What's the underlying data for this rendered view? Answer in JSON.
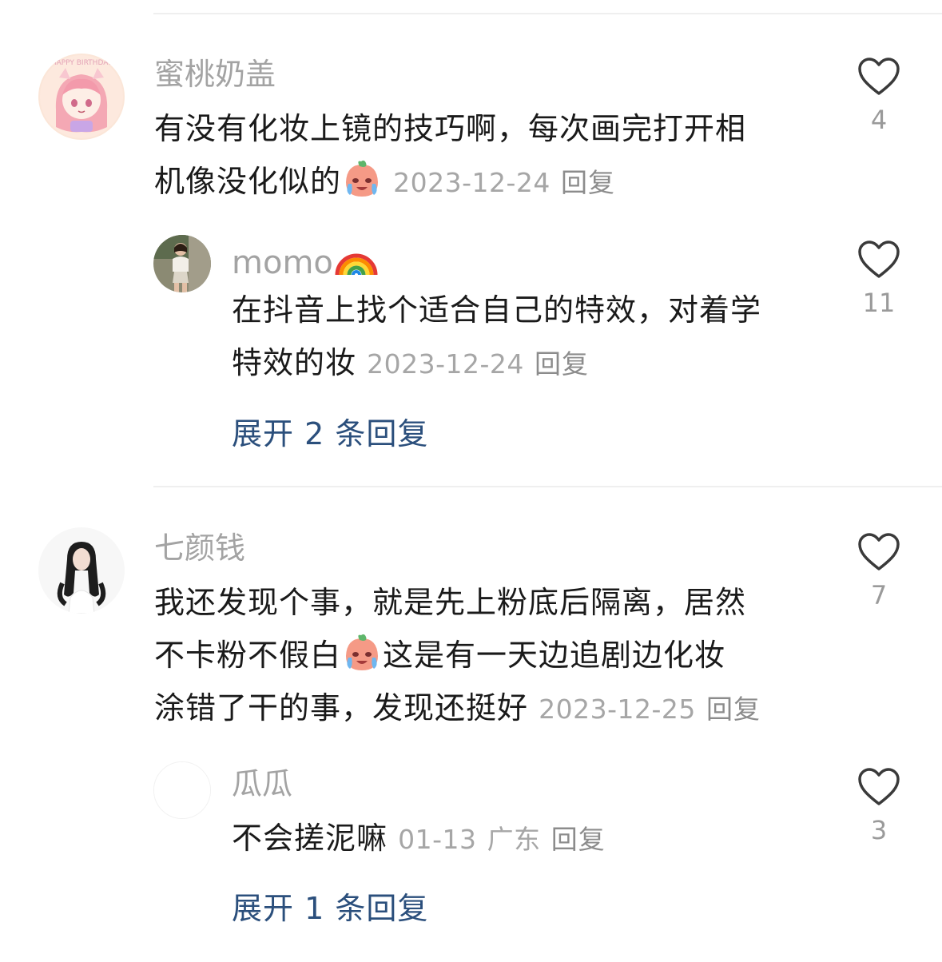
{
  "comments": [
    {
      "username": "蜜桃奶盖",
      "text_lines": [
        "有没有化妆上镜的技巧啊，每次画完打开相",
        "机像没化似的"
      ],
      "emoji": "crying-face-emoji",
      "date": "2023-12-24",
      "reply_label": "回复",
      "likes": "4",
      "replies": [
        {
          "username": "momo",
          "username_emoji": "rainbow-emoji",
          "text_lines": [
            "在抖音上找个适合自己的特效，对着学",
            "特效的妆"
          ],
          "date": "2023-12-24",
          "reply_label": "回复",
          "likes": "11"
        }
      ],
      "expand_label": "展开 2 条回复"
    },
    {
      "username": "七颜钱",
      "text_lines": [
        "我还发现个事，就是先上粉底后隔离，居然",
        "不卡粉不假白",
        "这是有一天边追剧边化妆",
        "涂错了干的事，发现还挺好"
      ],
      "emoji": "crying-face-emoji",
      "date": "2023-12-25",
      "reply_label": "回复",
      "likes": "7",
      "replies": [
        {
          "username": "瓜瓜",
          "text_lines": [
            "不会搓泥嘛"
          ],
          "date": "01-13",
          "location": "广东",
          "reply_label": "回复",
          "likes": "3"
        }
      ],
      "expand_label": "展开 1 条回复"
    }
  ]
}
